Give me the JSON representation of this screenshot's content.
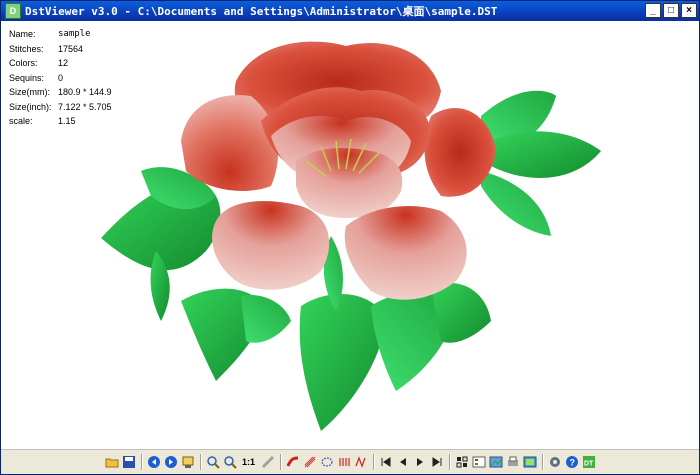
{
  "window": {
    "title": "DstViewer v3.0 - C:\\Documents and Settings\\Administrator\\桌面\\sample.DST",
    "controls": [
      "_",
      "□",
      "×"
    ]
  },
  "info": [
    {
      "label": "Name:",
      "value": "sample"
    },
    {
      "label": "Stitches:",
      "value": "17564"
    },
    {
      "label": "Colors:",
      "value": "12"
    },
    {
      "label": "Sequins:",
      "value": "0"
    },
    {
      "label": "Size(mm):",
      "value": "180.9 * 144.9"
    },
    {
      "label": "Size(inch):",
      "value": "7.122 * 5.705"
    },
    {
      "label": "scale:",
      "value": "1.15"
    }
  ],
  "toolbar": {
    "one_to_one_label": "1:1",
    "icons": [
      "open-folder-icon",
      "save-icon",
      "back-icon",
      "forward-icon",
      "print-preview-icon",
      "zoom-in-icon",
      "zoom-out-icon",
      "actual-size-icon",
      "measure-icon",
      "stitch-red-icon",
      "stitch-fill-icon",
      "stitch-outline-icon",
      "stitch-satin-icon",
      "stitch-run-icon",
      "first-icon",
      "prev-icon",
      "next-icon",
      "last-icon",
      "grid-icon",
      "color-table-icon",
      "export-image-icon",
      "print-icon",
      "properties-icon",
      "settings-icon",
      "help-icon",
      "about-dst-icon"
    ]
  },
  "colors": {
    "title_bar": "#0a3fba",
    "petal_dark": "#c8321e",
    "petal_light": "#e79a96",
    "leaf_dark": "#138a2e",
    "leaf_light": "#33d35a"
  }
}
